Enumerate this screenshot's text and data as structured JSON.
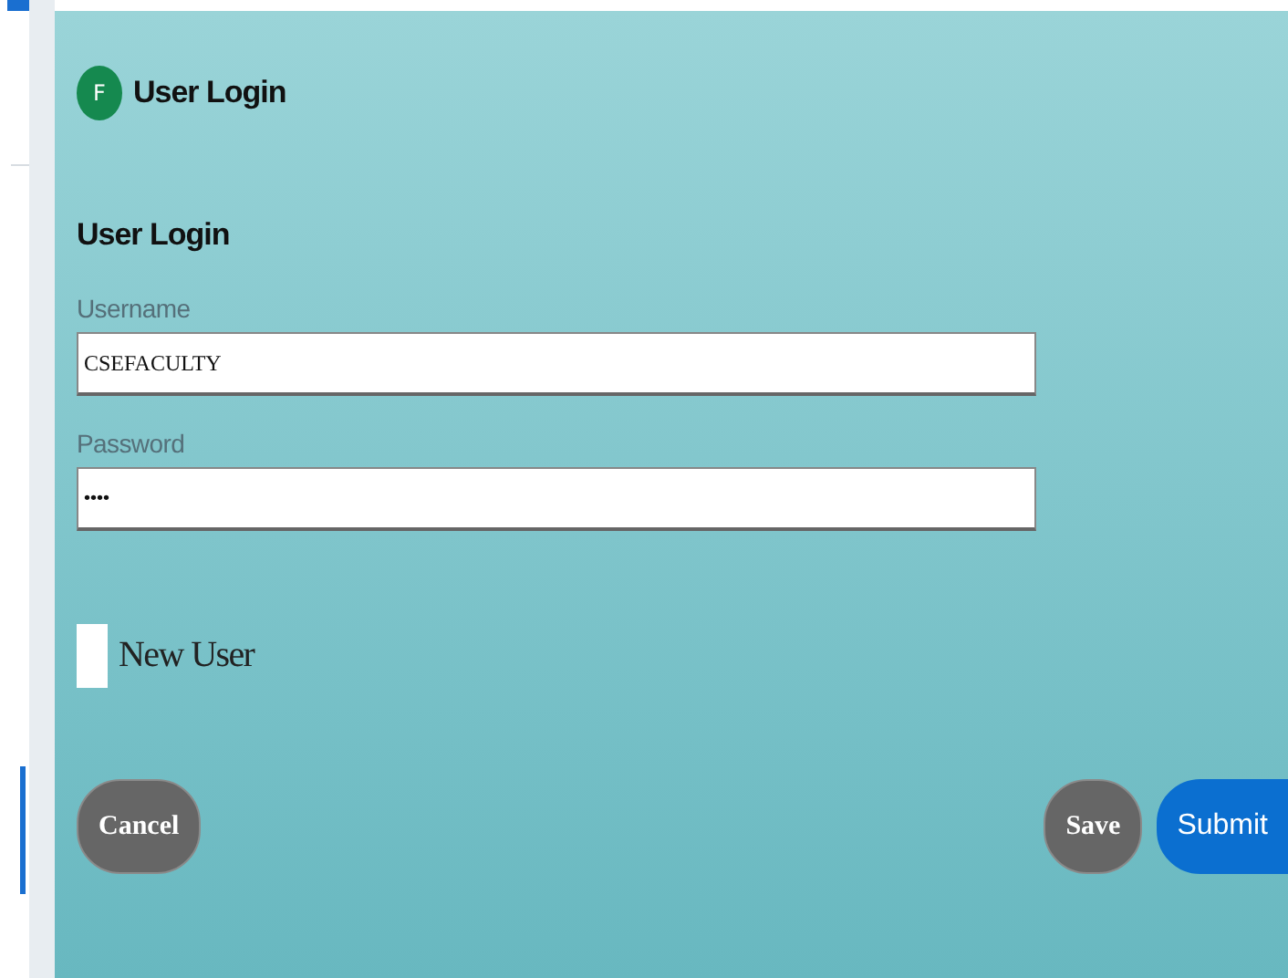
{
  "header": {
    "avatar_letter": "F",
    "title": "User Login"
  },
  "form": {
    "heading": "User Login",
    "fields": [
      {
        "label": "Username",
        "value": "CSEFACULTY",
        "kind": "text"
      },
      {
        "label": "Password",
        "value": "••••",
        "kind": "password"
      }
    ],
    "new_user": {
      "label": "New User",
      "checked": false
    }
  },
  "buttons": [
    {
      "label": "Cancel",
      "kind": "secondary"
    },
    {
      "label": "Save",
      "kind": "secondary"
    },
    {
      "label": "Submit",
      "kind": "primary"
    }
  ]
}
